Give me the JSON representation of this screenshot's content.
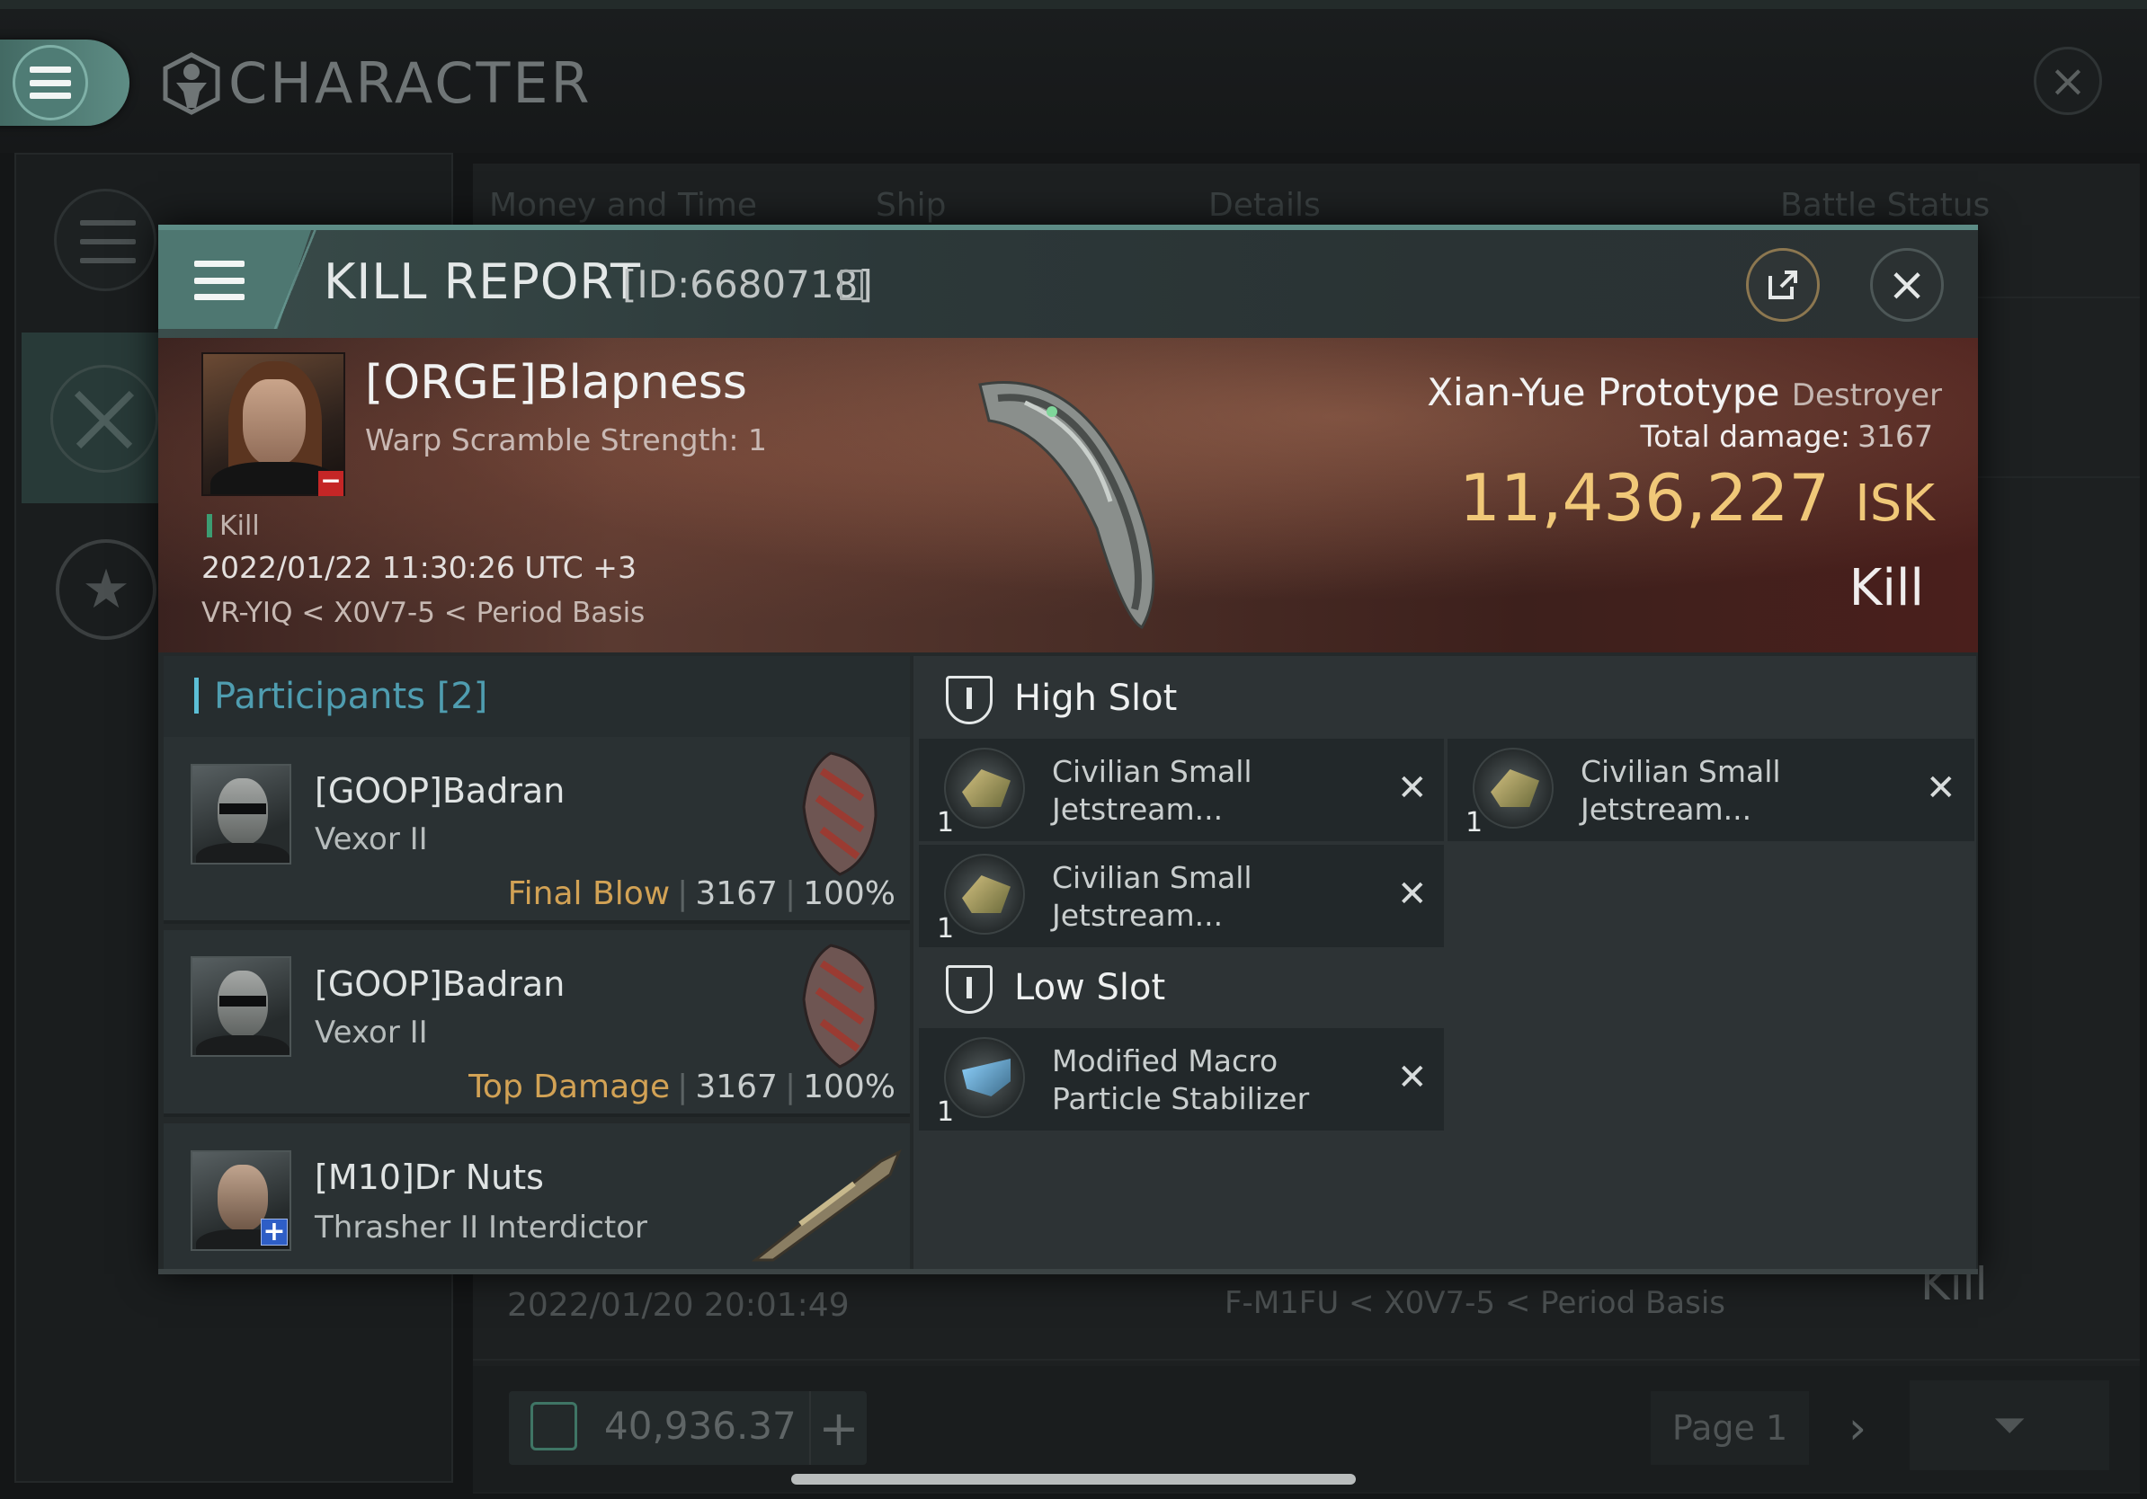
{
  "background_window": {
    "title": "CHARACTER",
    "columns": [
      "Money and Time",
      "Ship",
      "Details",
      "Battle Status"
    ],
    "visible_row": {
      "date": "2022/01/20  20:01:49",
      "location": "F-M1FU < X0V7-5 < Period Basis",
      "result": "Kill"
    },
    "balance": "40,936.37",
    "page": "Page 1",
    "icons": [
      "menu-icon",
      "character-icon",
      "close-icon",
      "list-icon",
      "combat-icon",
      "star-icon",
      "wallet-icon",
      "plus-icon",
      "chevron-right-icon",
      "filter-icon"
    ]
  },
  "kill_report": {
    "title": "KILL REPORT",
    "id": "[ID:6680718]",
    "victim": {
      "name": "[ORGE]Blapness",
      "warp_scramble": "Warp Scramble Strength: 1",
      "kill_tag": "Kill",
      "datetime": "2022/01/22 11:30:26 UTC +3",
      "location": "VR-YIQ < X0V7-5 < Period Basis"
    },
    "ship": {
      "name": "Xian-Yue Prototype",
      "class": "Destroyer",
      "total_damage_label": "Total damage:",
      "total_damage": "3167",
      "isk_value": "11,436,227",
      "isk_unit": "ISK",
      "result": "Kill"
    },
    "participants": {
      "label": "Participants",
      "count": "[2]",
      "rows": [
        {
          "name": "[GOOP]Badran",
          "ship": "Vexor II",
          "tag": "Final Blow",
          "damage": "3167",
          "percent": "100%"
        },
        {
          "name": "[GOOP]Badran",
          "ship": "Vexor II",
          "tag": "Top Damage",
          "damage": "3167",
          "percent": "100%"
        },
        {
          "name": "[M10]Dr Nuts",
          "ship": "Thrasher II Interdictor"
        }
      ]
    },
    "high_slot": {
      "label": "High Slot",
      "modules": [
        {
          "qty": "1",
          "name_line1": "Civilian Small",
          "name_line2": "Jetstream..."
        },
        {
          "qty": "1",
          "name_line1": "Civilian Small",
          "name_line2": "Jetstream..."
        },
        {
          "qty": "1",
          "name_line1": "Civilian Small",
          "name_line2": "Jetstream..."
        }
      ]
    },
    "low_slot": {
      "label": "Low Slot",
      "modules": [
        {
          "qty": "1",
          "name_line1": "Modified Macro",
          "name_line2": "Particle Stabilizer"
        }
      ]
    },
    "colors": {
      "accent": "#5d8c86",
      "isk": "#f0c878",
      "final_blow": "#d2a255",
      "participants": "#4f9db0"
    }
  }
}
